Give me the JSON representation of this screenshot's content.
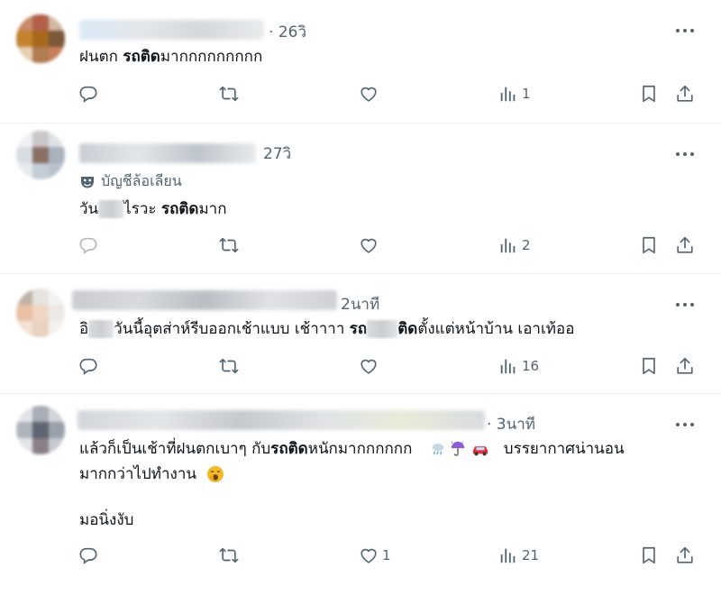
{
  "tweets": [
    {
      "time": "· 26วิ",
      "line1_a": "ฝนตก ",
      "line1_b": "รถติด",
      "line1_c": "มากกกกกกกกก",
      "views": "1"
    },
    {
      "time": "27วิ",
      "anon_label": "บัญชีล้อเลียน",
      "line1_a": "วัน",
      "line1_b": "ไรวะ ",
      "line1_c": "รถติด",
      "line1_d": "มาก",
      "views": "2"
    },
    {
      "time": "2นาที",
      "line1_a": "อิ",
      "line1_b": "วันนี้อุตส่าห์รีบออกเช้าแบบ เช้าาาา ",
      "line1_c": "รถ",
      "line1_d": "ติด",
      "line1_e": "ตั้งแต่หน้าบ้าน เอาเท้ออ",
      "views": "16"
    },
    {
      "time": "· 3นาที",
      "line1_a": "แล้วก็เป็นเช้าที่ฝนตกเบาๆ กับ",
      "line1_b": "รถติด",
      "line1_c": "หนักมากกกกกก",
      "line1_d": "บรรยากาศน่านอน",
      "line2": "มากกว่าไปทำงาน",
      "line3": "มอนิ่งงับ",
      "likes": "1",
      "views": "21"
    }
  ],
  "icons": {
    "reply": "reply-icon",
    "retweet": "retweet-icon",
    "like": "heart-icon",
    "views": "views-icon",
    "bookmark": "bookmark-icon",
    "share": "share-icon",
    "more": "more-icon",
    "mask": "theater-mask-icon"
  },
  "colors": {
    "icon": "#536471",
    "text": "#0f1419",
    "divider": "#eff3f4"
  }
}
